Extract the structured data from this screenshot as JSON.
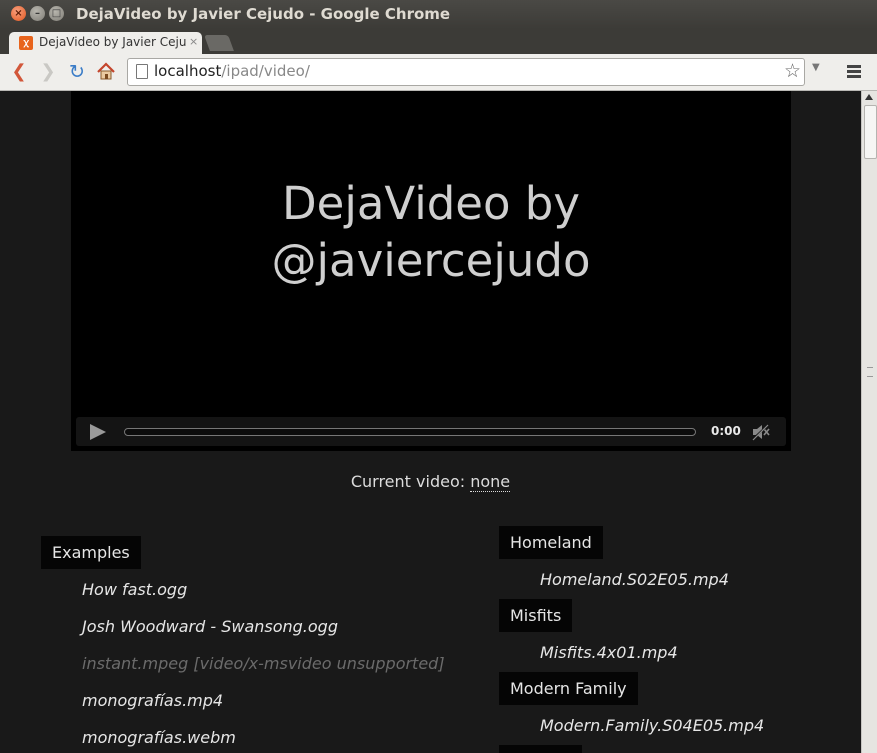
{
  "window": {
    "title": "DejaVideo by Javier Cejudo - Google Chrome"
  },
  "tab": {
    "title": "DejaVideo by Javier Cejudo",
    "close_glyph": "×"
  },
  "toolbar": {
    "back_glyph": "❮",
    "forward_glyph": "❯",
    "reload_glyph": "↻",
    "url_host": "localhost",
    "url_path": "/ipad/video/",
    "star_glyph": "☆",
    "dropdown_glyph": "▼"
  },
  "player": {
    "title_line1": "DejaVideo by",
    "title_line2": "@javiercejudo",
    "time": "0:00",
    "progress": 0
  },
  "current_video": {
    "label": "Current video:",
    "value": "none"
  },
  "left_group": {
    "label": "Examples",
    "files": [
      {
        "name": "How fast.ogg",
        "supported": true
      },
      {
        "name": "Josh Woodward - Swansong.ogg",
        "supported": true
      },
      {
        "name": "instant.mpeg [video/x-msvideo unsupported]",
        "supported": false
      },
      {
        "name": "monografías.mp4",
        "supported": true
      },
      {
        "name": "monografías.webm",
        "supported": true
      }
    ]
  },
  "right_groups": [
    {
      "label": "Homeland",
      "files": [
        "Homeland.S02E05.mp4"
      ]
    },
    {
      "label": "Misfits",
      "files": [
        "Misfits.4x01.mp4"
      ]
    },
    {
      "label": "Modern Family",
      "files": [
        "Modern.Family.S04E05.mp4"
      ]
    }
  ],
  "colors": {
    "page_background": "#191919",
    "video_background": "#000000",
    "unsupported_text": "#6b6b6b"
  }
}
